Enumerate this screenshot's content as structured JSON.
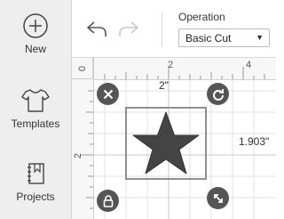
{
  "sidebar": {
    "items": [
      {
        "label": "New",
        "icon": "plus-circle-icon"
      },
      {
        "label": "Templates",
        "icon": "tshirt-icon"
      },
      {
        "label": "Projects",
        "icon": "projects-book-icon"
      }
    ]
  },
  "toolbar": {
    "undo_icon": "undo-icon",
    "redo_icon": "redo-icon",
    "operation_label": "Operation",
    "operation_value": "Basic Cut"
  },
  "canvas": {
    "ruler_h": [
      "0",
      "2",
      "4"
    ],
    "ruler_v": [
      "2"
    ],
    "width_text": "2\"",
    "height_text": "1.903\"",
    "shape": "star"
  },
  "colors": {
    "sidebar_bg": "#eeeeee",
    "handle": "#555555",
    "star": "#444444",
    "selection_border": "#8f8f8f"
  }
}
